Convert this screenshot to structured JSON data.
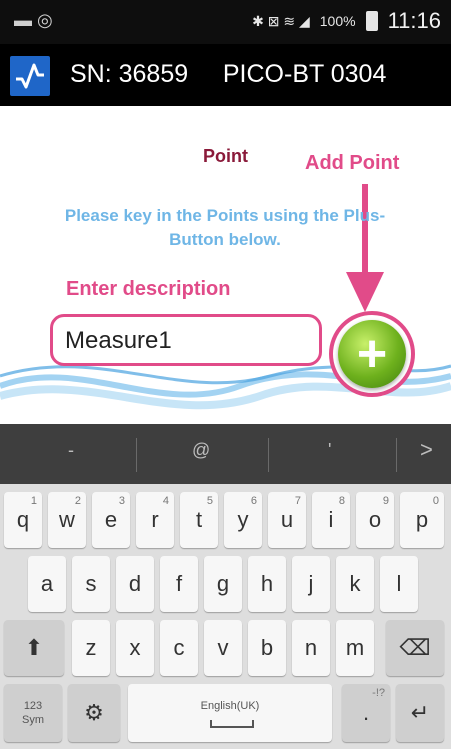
{
  "status_bar": {
    "left_icons": "▬ ◎",
    "right_icons": "✱ ⊠ ≋ ◢",
    "battery_percent": "100%",
    "time": "11:16"
  },
  "app_bar": {
    "title": "SN: 36859     PICO-BT 0304"
  },
  "content": {
    "point_title": "Point",
    "add_point_label": "Add Point",
    "instruction": "Please key in the Points using the Plus-Button below.",
    "enter_description_label": "Enter description",
    "description_value": "Measure1",
    "plus_symbol": "+",
    "accent_color": "#e14b89"
  },
  "keyboard": {
    "suggestions": [
      "-",
      "@",
      "'",
      ">"
    ],
    "row1": [
      {
        "key": "q",
        "sup": "1"
      },
      {
        "key": "w",
        "sup": "2"
      },
      {
        "key": "e",
        "sup": "3"
      },
      {
        "key": "r",
        "sup": "4"
      },
      {
        "key": "t",
        "sup": "5"
      },
      {
        "key": "y",
        "sup": "6"
      },
      {
        "key": "u",
        "sup": "7"
      },
      {
        "key": "i",
        "sup": "8"
      },
      {
        "key": "o",
        "sup": "9"
      },
      {
        "key": "p",
        "sup": "0"
      }
    ],
    "row2": [
      "a",
      "s",
      "d",
      "f",
      "g",
      "h",
      "j",
      "k",
      "l"
    ],
    "row3": [
      "z",
      "x",
      "c",
      "v",
      "b",
      "n",
      "m"
    ],
    "shift_symbol": "⬆",
    "backspace_symbol": "⌫",
    "sym_top": "123",
    "sym_bottom": "Sym",
    "settings_symbol": "⚙",
    "space_label": "English(UK)",
    "period_label": ".",
    "period_sup": "-!?",
    "enter_symbol": "↵"
  }
}
